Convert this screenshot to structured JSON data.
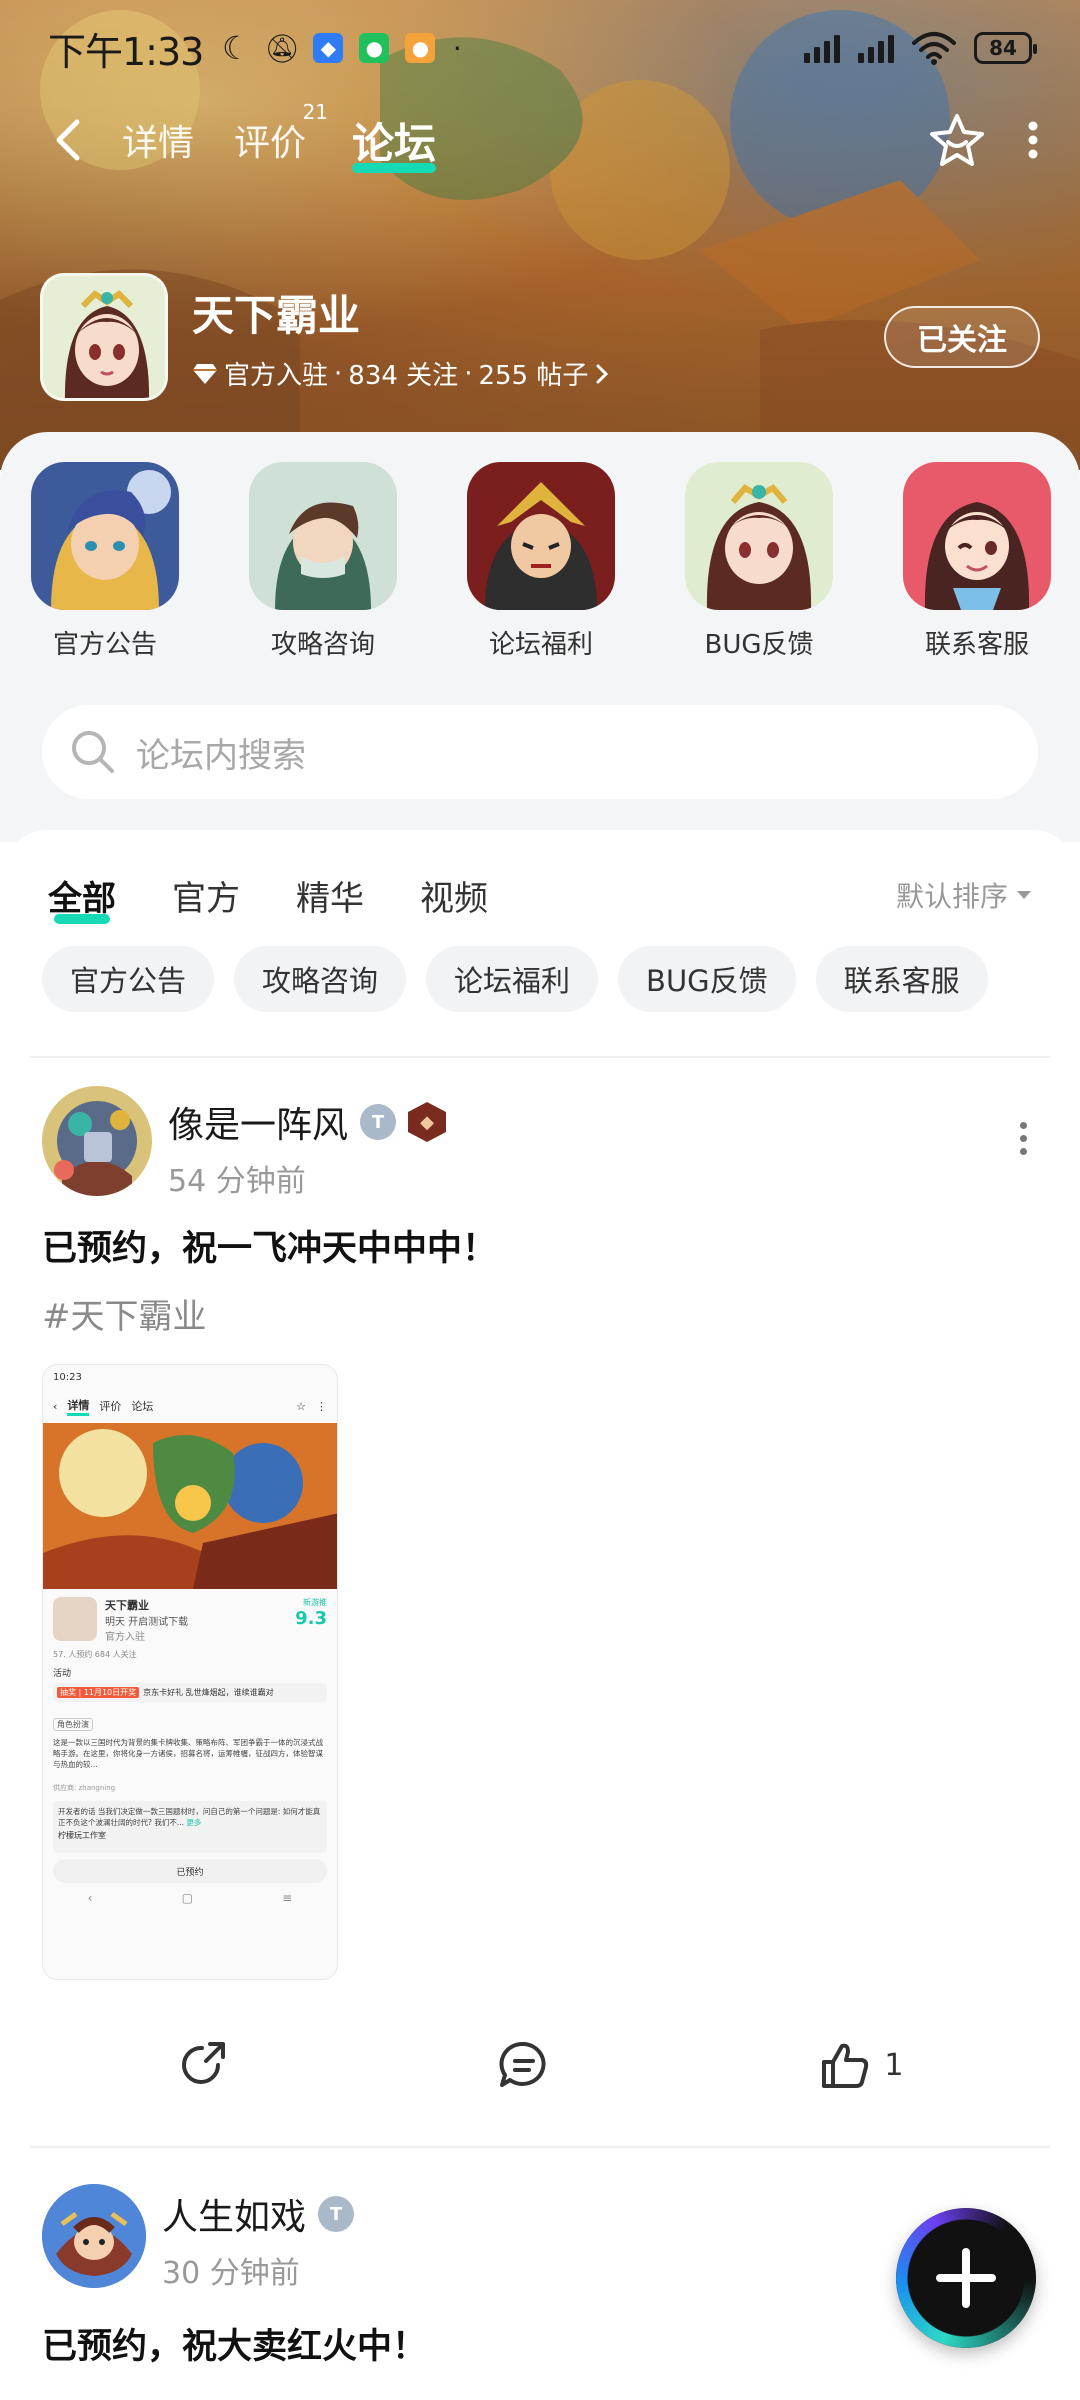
{
  "status_bar": {
    "time": "下午1:33",
    "battery": "84"
  },
  "nav": {
    "tabs": [
      {
        "label": "详情"
      },
      {
        "label": "评价",
        "badge": "21"
      },
      {
        "label": "论坛",
        "active": true
      }
    ]
  },
  "forum": {
    "name": "天下霸业",
    "official": "官方入驻",
    "followers": "834 关注",
    "posts": "255 帖子",
    "follow_label": "已关注"
  },
  "categories": [
    {
      "label": "官方公告"
    },
    {
      "label": "攻略咨询"
    },
    {
      "label": "论坛福利"
    },
    {
      "label": "BUG反馈"
    },
    {
      "label": "联系客服"
    }
  ],
  "search": {
    "placeholder": "论坛内搜索"
  },
  "tabs": [
    {
      "label": "全部",
      "active": true
    },
    {
      "label": "官方"
    },
    {
      "label": "精华"
    },
    {
      "label": "视频"
    }
  ],
  "sort_label": "默认排序",
  "chips": [
    "官方公告",
    "攻略咨询",
    "论坛福利",
    "BUG反馈",
    "联系客服"
  ],
  "posts": [
    {
      "author": "像是一阵风",
      "time": "54 分钟前",
      "title": "已预约，祝一飞冲天中中中！",
      "tag": "#天下霸业",
      "like_count": "1",
      "screenshot": {
        "time": "10:23",
        "tab_detail": "详情",
        "tab_review": "评价",
        "tab_forum": "论坛",
        "game_name": "天下霸业",
        "game_sub": "明天 开启测试下载",
        "game_official": "官方入驻",
        "score_label": "新游推",
        "score": "9.3",
        "stats": "57. 人预约    684 人关注",
        "activity": "活动",
        "event": "京东卡好礼 乱世烽烟起，谁续谁霸对",
        "event_tag": "抽奖 | 11月10日开奖",
        "section": "角色扮演",
        "desc": "这是一款以三国时代为背景的集卡牌收集、策略布阵、军团争霸于一体的沉浸式战略手游。在这里，你将化身一方诸侯，招募名将，运筹帷幄，征战四方，体验智谋与热血的较...",
        "publisher": "供应商: zhangning",
        "dev_note": "开发者的话  当我们决定做一款三国题材时，问自己的第一个问题是: 如何才能真正不负这个波澜壮阔的时代? 我们不...",
        "more": "更多",
        "studio": "柠檬玩工作室",
        "bottom_btn": "已预约"
      }
    },
    {
      "author": "人生如戏",
      "time": "30 分钟前",
      "title": "已预约，祝大卖红火中！"
    }
  ]
}
